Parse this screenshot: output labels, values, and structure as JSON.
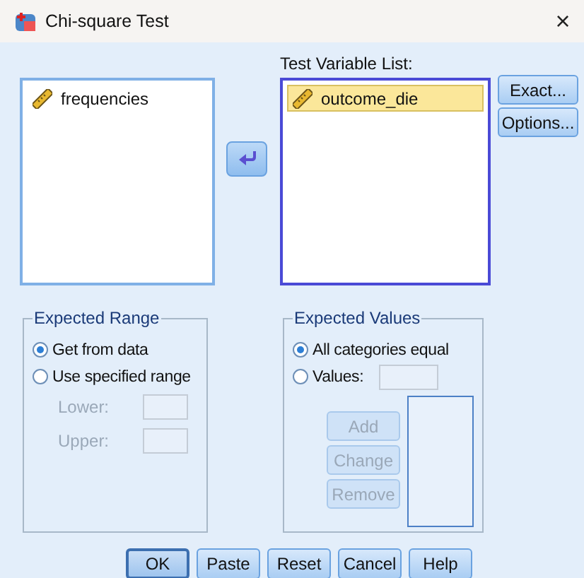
{
  "window": {
    "title": "Chi-square Test",
    "close": "×"
  },
  "source_list": {
    "items": [
      {
        "label": "frequencies",
        "selected": false
      }
    ]
  },
  "move_button": {
    "disabled": false
  },
  "test_list": {
    "label": "Test Variable List:",
    "items": [
      {
        "label": "outcome_die",
        "selected": true
      }
    ]
  },
  "side_buttons": [
    {
      "label": "Exact..."
    },
    {
      "label": "Options..."
    }
  ],
  "expected_range": {
    "title": "Expected Range",
    "options": [
      {
        "label": "Get from data",
        "selected": true
      },
      {
        "label": "Use specified range",
        "selected": false
      }
    ],
    "fields": [
      {
        "label": "Lower:",
        "disabled": true
      },
      {
        "label": "Upper:",
        "disabled": true
      }
    ]
  },
  "expected_values": {
    "title": "Expected Values",
    "options": [
      {
        "label": "All categories equal",
        "selected": true
      },
      {
        "label": "Values:",
        "selected": false
      }
    ],
    "buttons": [
      {
        "label": "Add",
        "disabled": true
      },
      {
        "label": "Change",
        "disabled": true
      },
      {
        "label": "Remove",
        "disabled": true
      }
    ]
  },
  "buttons": [
    {
      "label": "OK",
      "default": true
    },
    {
      "label": "Paste",
      "default": false
    },
    {
      "label": "Reset",
      "default": false
    },
    {
      "label": "Cancel",
      "default": false
    },
    {
      "label": "Help",
      "default": false
    }
  ]
}
